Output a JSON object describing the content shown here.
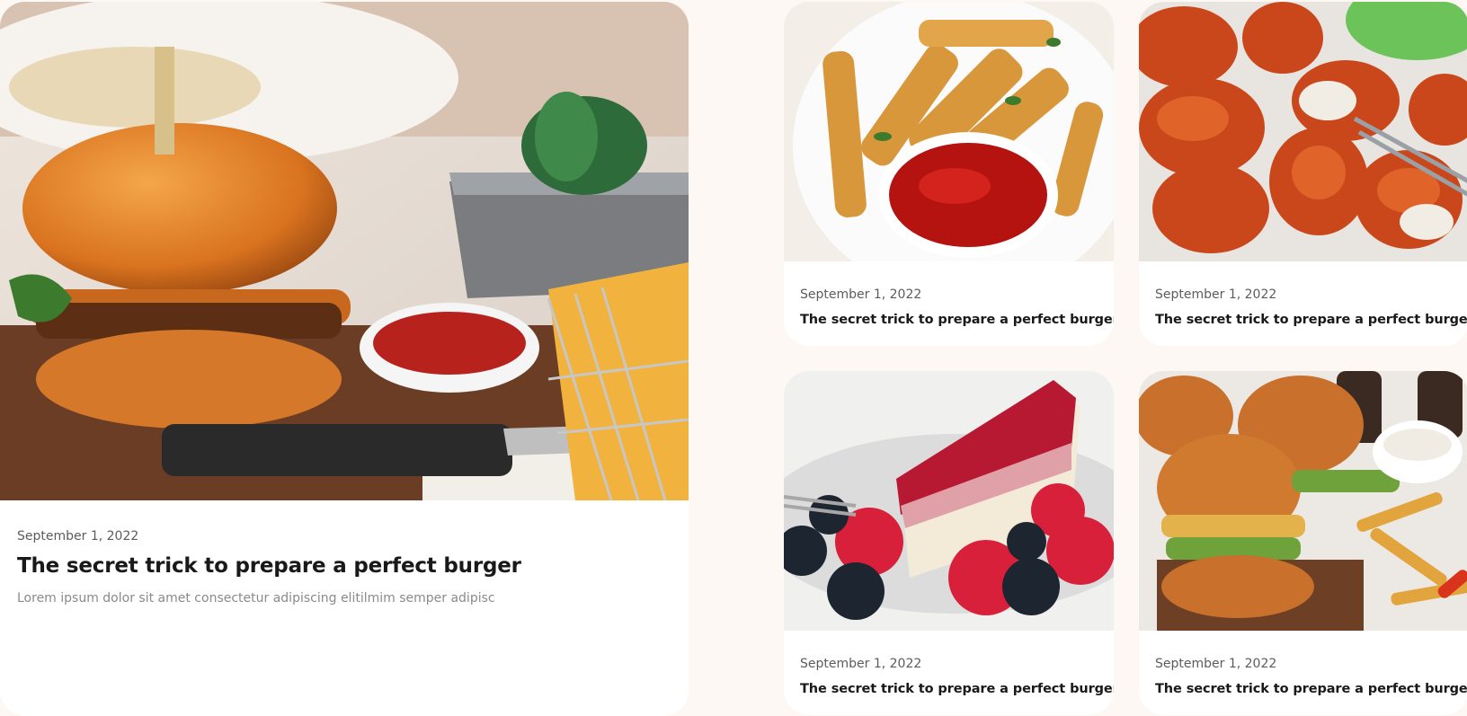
{
  "featured": {
    "image_alt": "Burger with fries and ketchup",
    "date": "September 1, 2022",
    "title": "The secret trick to prepare a perfect burger",
    "excerpt": "Lorem ipsum dolor sit amet consectetur adipiscing elitilmim semper adipisc"
  },
  "posts": [
    {
      "image_alt": "Potato wedges with ketchup",
      "date": "September 1, 2022",
      "title": "The secret trick to prepare a perfect burger"
    },
    {
      "image_alt": "Fried chicken wings",
      "date": "September 1, 2022",
      "title": "The secret trick to prepare a perfect burger"
    },
    {
      "image_alt": "Cheesecake with berries",
      "date": "September 1, 2022",
      "title": "The secret trick to prepare a perfect burger"
    },
    {
      "image_alt": "Mini burgers with fries",
      "date": "September 1, 2022",
      "title": "The secret trick to prepare a perfect burger"
    }
  ]
}
